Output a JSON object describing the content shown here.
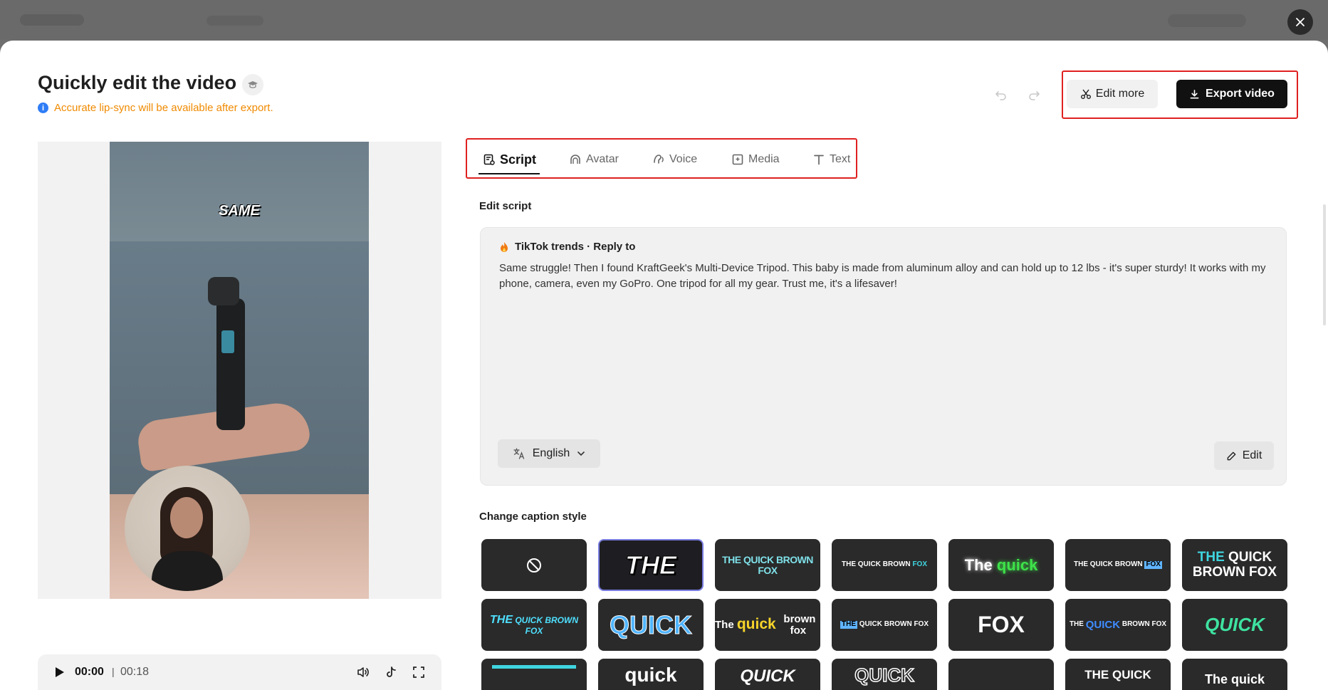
{
  "modal": {
    "title": "Quickly edit the video",
    "notice": "Accurate lip-sync will be available after export.",
    "edit_more_label": "Edit more",
    "export_label": "Export video"
  },
  "preview": {
    "overlay_text": "SAME",
    "time_current": "00:00",
    "time_separator": "|",
    "time_total": "00:18",
    "progress": 0
  },
  "tabs": [
    {
      "label": "Script",
      "icon": "script-icon",
      "active": true
    },
    {
      "label": "Avatar",
      "icon": "avatar-icon",
      "active": false
    },
    {
      "label": "Voice",
      "icon": "voice-icon",
      "active": false
    },
    {
      "label": "Media",
      "icon": "media-icon",
      "active": false
    },
    {
      "label": "Text",
      "icon": "text-icon",
      "active": false
    }
  ],
  "script": {
    "section_label": "Edit script",
    "source": "TikTok trends · Reply to",
    "text": "Same struggle! Then I found KraftGeek's Multi-Device Tripod. This baby is made from aluminum alloy and can hold up to 12 lbs - it's super sturdy! It works with my phone, camera, even my GoPro. One tripod for all my gear. Trust me, it's a lifesaver!",
    "language": "English",
    "edit_label": "Edit"
  },
  "captions": {
    "section_label": "Change caption style",
    "styles": [
      {
        "text": "",
        "kind": "none"
      },
      {
        "text": "THE",
        "kind": "selected"
      },
      {
        "text": "THE QUICK BROWN FOX",
        "color": "#7fe0e8"
      },
      {
        "text": "THE QUICK BROWN FOX",
        "color": "#ffffff",
        "accent": "#3fd6e0"
      },
      {
        "text": "The quick",
        "color": "#ffffff",
        "accent": "#3ee24a"
      },
      {
        "text": "THE QUICK BROWN FOX",
        "color": "#ffffff",
        "accent": "#5fb4ff"
      },
      {
        "text": "THE QUICK BROWN FOX",
        "color": "#ffffff",
        "accent": "#3fd6e0"
      },
      {
        "text": "THE QUICK BROWN FOX",
        "color": "#4fe0ff"
      },
      {
        "text": "QUICK",
        "color": "#4fb4ff"
      },
      {
        "text": "The quick brown fox",
        "color": "#ffffff",
        "accent": "#f7d42a"
      },
      {
        "text": "THE QUICK BROWN FOX",
        "color": "#ffffff",
        "accent": "#5fb4ff"
      },
      {
        "text": "FOX",
        "color": "#ffffff"
      },
      {
        "text": "THE QUICK BROWN FOX",
        "color": "#ffffff",
        "accent": "#3f8cff"
      },
      {
        "text": "QUICK",
        "color": "#3ee2a0"
      },
      {
        "text": "",
        "color": "#3fd6e0"
      },
      {
        "text": "quick",
        "color": "#ffffff"
      },
      {
        "text": "QUICK",
        "color": "#ffffff"
      },
      {
        "text": "QUICK",
        "color": "#ffffff"
      },
      {
        "text": "",
        "color": "#ffffff"
      },
      {
        "text": "THE QUICK",
        "color": "#ffffff"
      },
      {
        "text": "The quick",
        "color": "#ffffff"
      }
    ]
  },
  "colors": {
    "accent_red_outline": "#e02020",
    "notice_orange": "#f08a00",
    "info_blue": "#2f7cf6"
  }
}
